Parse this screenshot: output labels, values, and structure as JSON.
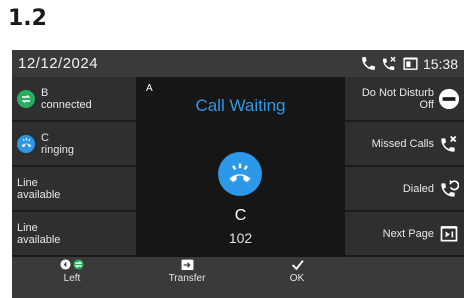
{
  "step_title": "1.2",
  "status_bar": {
    "date": "12/12/2024",
    "time": "15:38",
    "icons": [
      "handset-icon",
      "missed-call-icon",
      "screen-icon"
    ]
  },
  "left_keys": [
    {
      "line1": "B",
      "line2": "connected",
      "icon": "transfer-arrows-icon",
      "icon_color": "#27ae60"
    },
    {
      "line1": "C",
      "line2": "ringing",
      "icon": "ringing-handset-icon",
      "icon_color": "#2d98e8"
    },
    {
      "line1": "Line",
      "line2": "available"
    },
    {
      "line1": "Line",
      "line2": "available"
    }
  ],
  "right_keys": [
    {
      "line1": "Do Not Disturb",
      "line2": "Off",
      "icon": "dnd-icon"
    },
    {
      "line1": "Missed Calls",
      "icon": "missed-calls-icon"
    },
    {
      "line1": "Dialed",
      "icon": "dialed-calls-icon"
    },
    {
      "line1": "Next Page",
      "icon": "next-page-icon"
    }
  ],
  "center": {
    "line_label": "A",
    "call_state": "Call Waiting",
    "caller_name": "C",
    "caller_number": "102",
    "accent_color": "#2d98e8"
  },
  "softkeys": [
    {
      "label": "Left",
      "icon": "left-line-icon"
    },
    {
      "label": "Transfer",
      "icon": "transfer-icon"
    },
    {
      "label": "OK",
      "icon": "checkmark-icon"
    }
  ]
}
